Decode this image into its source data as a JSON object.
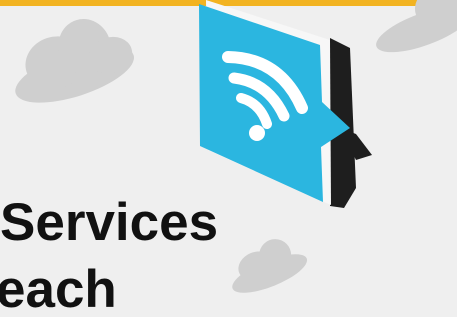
{
  "banner": {
    "headline_line_1": "Services",
    "headline_line_2": "each"
  },
  "illustration": {
    "icon": "wifi-speech-bubble-icon",
    "bubble_color": "#2bb6e0",
    "bubble_side_color": "#1e1e1e",
    "cloud_color": "#cfcfcf",
    "accent_strip_color": "#f2b321"
  }
}
